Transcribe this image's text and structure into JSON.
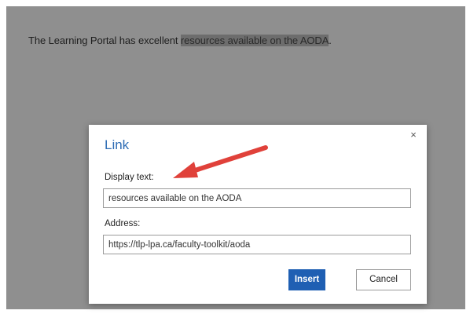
{
  "document": {
    "text_before": "The Learning Portal has excellent ",
    "selected_text": "resources available on the AODA",
    "text_after": "."
  },
  "dialog": {
    "title": "Link",
    "close_glyph": "×",
    "display_label": "Display text:",
    "display_value": "resources available on the AODA",
    "address_label": "Address:",
    "address_value": "https://tlp-lpa.ca/faculty-toolkit/aoda",
    "insert_label": "Insert",
    "cancel_label": "Cancel"
  },
  "colors": {
    "backdrop": "#8f8f8f",
    "title": "#2f6db5",
    "insert_button": "#1f5fb3",
    "arrow": "#e0413a"
  },
  "icons": {
    "close": "close-icon",
    "annotation": "arrow-annotation-icon"
  }
}
